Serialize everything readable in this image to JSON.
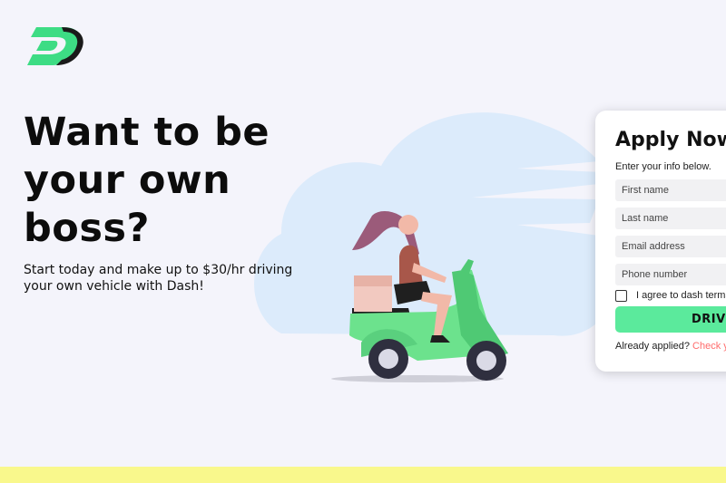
{
  "brand": {
    "logo_letter": "D",
    "logo_color": "#3ddc84"
  },
  "hero": {
    "title": "Want to be your own boss?",
    "subtitle": "Start today and make up to $30/hr driving your own vehicle with Dash!"
  },
  "form": {
    "title": "Apply Now",
    "subtitle": "Enter your info below.",
    "first_name_placeholder": "First name",
    "last_name_placeholder": "Last name",
    "email_placeholder": "Email address",
    "phone_placeholder": "Phone number",
    "terms_label": "I agree to dash terms",
    "submit_label": "DRIVE",
    "applied_text": "Already applied?",
    "applied_link": "Check your status"
  },
  "colors": {
    "accent": "#5bea9c",
    "link": "#ff6b6b",
    "footer": "#f9f88c",
    "background": "#f4f4fb"
  }
}
